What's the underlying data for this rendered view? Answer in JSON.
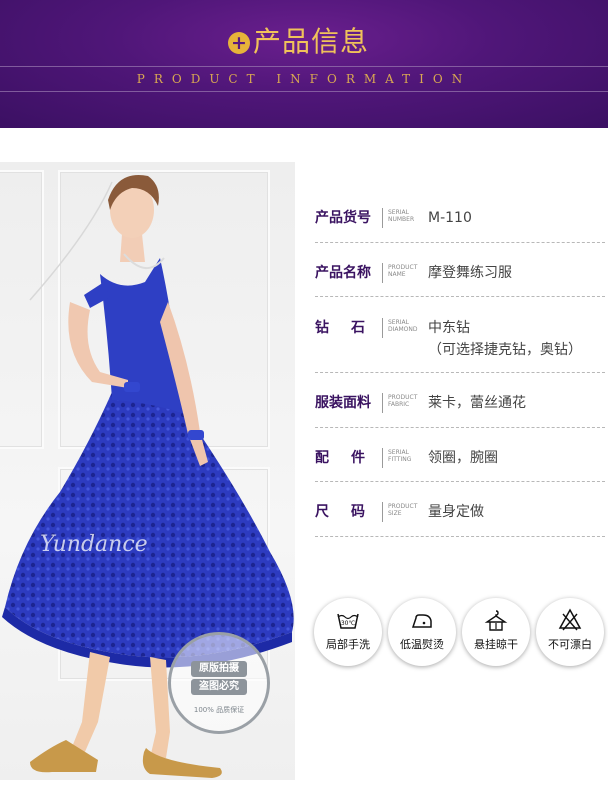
{
  "header": {
    "title": "产品信息",
    "subtitle": "PRODUCT INFORMATION",
    "plus_icon": "plus-icon"
  },
  "photo": {
    "watermark": "Yundance",
    "stamp": {
      "line1": "原版拍摄",
      "line2": "盗图必究",
      "bottom": "100% 品质保证"
    }
  },
  "specs": [
    {
      "label": "产品货号",
      "en1": "SERIAL",
      "en2": "NUMBER",
      "value": "M-110"
    },
    {
      "label": "产品名称",
      "en1": "PRODUCT",
      "en2": "NAME",
      "value": "摩登舞练习服"
    },
    {
      "label": "钻石",
      "en1": "SERIAL",
      "en2": "DIAMOND",
      "value": "中东钻",
      "value2": "（可选择捷克钻，奥钻）"
    },
    {
      "label": "服装面料",
      "en1": "PRODUCT",
      "en2": "FABRIC",
      "value": "莱卡，蕾丝通花"
    },
    {
      "label": "配件",
      "en1": "SERIAL",
      "en2": "FITTING",
      "value": "领圈，腕圈"
    },
    {
      "label": "尺码",
      "en1": "PRODUCT",
      "en2": "SIZE",
      "value": "量身定做"
    }
  ],
  "care": [
    {
      "icon": "hand-wash-icon",
      "label": "局部手洗",
      "temp": "30℃"
    },
    {
      "icon": "low-iron-icon",
      "label": "低温熨烫"
    },
    {
      "icon": "hang-dry-icon",
      "label": "悬挂晾干"
    },
    {
      "icon": "no-bleach-icon",
      "label": "不可漂白"
    }
  ],
  "colors": {
    "header_bg": "#4f1678",
    "gold": "#f0c25a",
    "label": "#3a1361",
    "dress_blue": "#2e3fc4"
  }
}
